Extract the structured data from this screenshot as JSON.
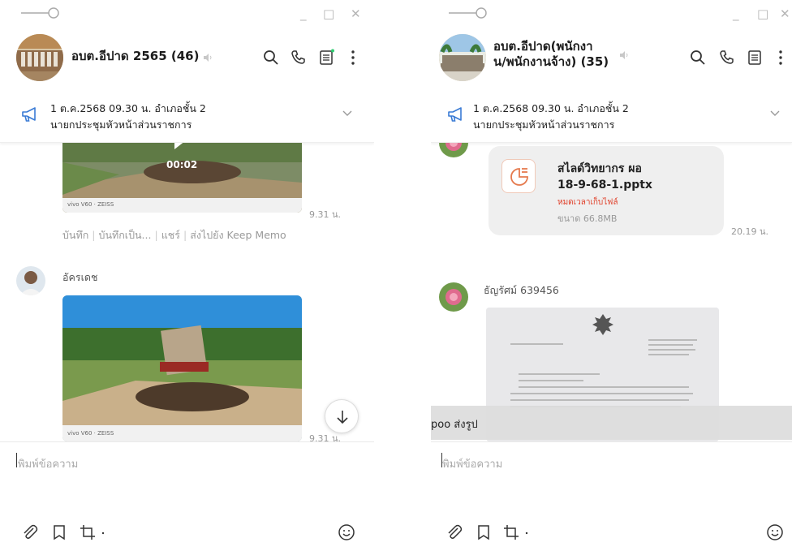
{
  "left": {
    "window_controls": {
      "minimize": "_",
      "maximize": "□",
      "close": "✕"
    },
    "header": {
      "title": "อบต.อีปาด 2565 (46)"
    },
    "announcement": {
      "line1": "1 ต.ค.2568 09.30 น. อำเภอชั้น 2",
      "line2": "นายกประชุมหัวหน้าส่วนราชการ"
    },
    "messages": {
      "video1": {
        "duration": "00:02",
        "time": "9.31 น.",
        "brand": "vivo V60 · ZEISS"
      },
      "actions": [
        "บันทึก",
        "บันทึกเป็น...",
        "แชร์",
        "ส่งไปยัง Keep Memo"
      ],
      "sender2": "อัครเดช",
      "video2": {
        "time": "9.31 น.",
        "brand": "vivo V60 · ZEISS"
      }
    },
    "composer": {
      "placeholder": "พิมพ์ข้อความ"
    },
    "icons": [
      "paperclip-icon",
      "bookmark-icon",
      "crop-icon",
      "emoji-icon",
      "search-icon",
      "phone-icon",
      "notes-icon",
      "more-icon"
    ]
  },
  "right": {
    "window_controls": {
      "minimize": "_",
      "maximize": "□",
      "close": "✕"
    },
    "header": {
      "title_line1": "อบต.อีปาด(พนักงา",
      "title_line2": "น/พนักงานจ้าง) (35)"
    },
    "announcement": {
      "line1": "1 ต.ค.2568 09.30 น. อำเภอชั้น 2",
      "line2": "นายกประชุมหัวหน้าส่วนราชการ"
    },
    "file": {
      "name_line1": "สไลด์วิทยากร ผอ",
      "name_line2": "18-9-68-1.pptx",
      "expired": "หมดเวลาเก็บไฟล์",
      "size": "ขนาด 66.8MB",
      "time": "20.19 น."
    },
    "sender2": "ธัญรัศม์ 639456",
    "toast": "poo ส่งรูป",
    "composer": {
      "placeholder": "พิมพ์ข้อความ"
    }
  },
  "colors": {
    "accent": "#3a7bd5",
    "expired": "#e0402a",
    "online_dot": "#2ecc71"
  }
}
